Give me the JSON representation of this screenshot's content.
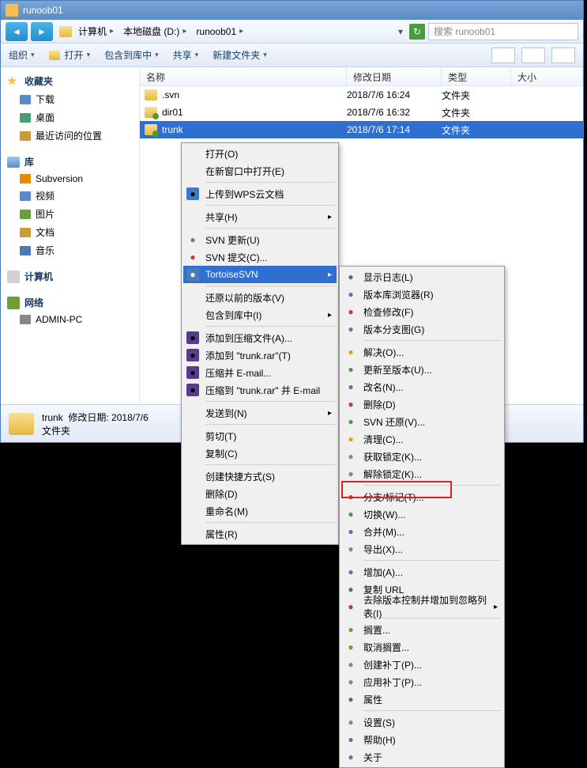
{
  "window": {
    "title": "runoob01"
  },
  "navbar": {
    "path": [
      {
        "label": "计算机"
      },
      {
        "label": "本地磁盘 (D:)"
      },
      {
        "label": "runoob01"
      }
    ],
    "search_placeholder": "搜索 runoob01"
  },
  "toolbar": {
    "organize": "组织",
    "open": "打开",
    "include": "包含到库中",
    "share": "共享",
    "newfolder": "新建文件夹"
  },
  "sidebar": {
    "favorites": {
      "title": "收藏夹",
      "items": [
        "下载",
        "桌面",
        "最近访问的位置"
      ]
    },
    "libraries": {
      "title": "库",
      "items": [
        "Subversion",
        "视频",
        "图片",
        "文档",
        "音乐"
      ]
    },
    "computer": {
      "title": "计算机"
    },
    "network": {
      "title": "网络",
      "items": [
        "ADMIN-PC"
      ]
    }
  },
  "columns": [
    "名称",
    "修改日期",
    "类型",
    "大小"
  ],
  "files": [
    {
      "name": ".svn",
      "date": "2018/7/6 16:24",
      "type": "文件夹"
    },
    {
      "name": "dir01",
      "date": "2018/7/6 16:32",
      "type": "文件夹"
    },
    {
      "name": "trunk",
      "date": "2018/7/6 17:14",
      "type": "文件夹"
    }
  ],
  "status": {
    "name": "trunk",
    "label1": "修改日期:",
    "date": "2018/7/6",
    "type": "文件夹"
  },
  "context1": [
    {
      "t": "打开(O)"
    },
    {
      "t": "在新窗口中打开(E)"
    },
    {
      "sep": true
    },
    {
      "t": "上传到WPS云文档",
      "ico": "wps"
    },
    {
      "sep": true
    },
    {
      "t": "共享(H)",
      "sub": true
    },
    {
      "sep": true
    },
    {
      "t": "SVN 更新(U)",
      "ico": "svn-u"
    },
    {
      "t": "SVN 提交(C)...",
      "ico": "svn-c"
    },
    {
      "t": "TortoiseSVN",
      "ico": "tsvn",
      "sub": true,
      "hl": true
    },
    {
      "sep": true
    },
    {
      "t": "还原以前的版本(V)"
    },
    {
      "t": "包含到库中(I)",
      "sub": true
    },
    {
      "sep": true
    },
    {
      "t": "添加到压缩文件(A)...",
      "ico": "rar"
    },
    {
      "t": "添加到 \"trunk.rar\"(T)",
      "ico": "rar"
    },
    {
      "t": "压缩并 E-mail...",
      "ico": "rar"
    },
    {
      "t": "压缩到 \"trunk.rar\" 并 E-mail",
      "ico": "rar"
    },
    {
      "sep": true
    },
    {
      "t": "发送到(N)",
      "sub": true
    },
    {
      "sep": true
    },
    {
      "t": "剪切(T)"
    },
    {
      "t": "复制(C)"
    },
    {
      "sep": true
    },
    {
      "t": "创建快捷方式(S)"
    },
    {
      "t": "删除(D)"
    },
    {
      "t": "重命名(M)"
    },
    {
      "sep": true
    },
    {
      "t": "属性(R)"
    }
  ],
  "context2": [
    {
      "t": "显示日志(L)",
      "ico": "log"
    },
    {
      "t": "版本库浏览器(R)",
      "ico": "repo"
    },
    {
      "t": "检查修改(F)",
      "ico": "check"
    },
    {
      "t": "版本分支图(G)",
      "ico": "graph"
    },
    {
      "sep": true
    },
    {
      "t": "解决(O)...",
      "ico": "resolve"
    },
    {
      "t": "更新至版本(U)...",
      "ico": "update"
    },
    {
      "t": "改名(N)...",
      "ico": "rename"
    },
    {
      "t": "删除(D)",
      "ico": "delete"
    },
    {
      "t": "SVN 还原(V)...",
      "ico": "revert"
    },
    {
      "t": "清理(C)...",
      "ico": "clean"
    },
    {
      "t": "获取锁定(K)...",
      "ico": "lock"
    },
    {
      "t": "解除锁定(K)...",
      "ico": "lock"
    },
    {
      "sep": true
    },
    {
      "t": "分支/标记(T)...",
      "ico": "branch"
    },
    {
      "t": "切换(W)...",
      "ico": "switch"
    },
    {
      "t": "合并(M)...",
      "ico": "merge"
    },
    {
      "t": "导出(X)...",
      "ico": "export"
    },
    {
      "sep": true
    },
    {
      "t": "增加(A)...",
      "ico": "add"
    },
    {
      "t": "复制 URL",
      "ico": "log"
    },
    {
      "t": "去除版本控制并增加到忽略列表(I)",
      "ico": "unver",
      "sub": true
    },
    {
      "sep": true
    },
    {
      "t": "搁置...",
      "ico": "shelve"
    },
    {
      "t": "取消搁置...",
      "ico": "shelve"
    },
    {
      "t": "创建补丁(P)...",
      "ico": "patch"
    },
    {
      "t": "应用补丁(P)...",
      "ico": "patch"
    },
    {
      "t": "属性",
      "ico": "log"
    },
    {
      "sep": true
    },
    {
      "t": "设置(S)",
      "ico": "settings"
    },
    {
      "t": "帮助(H)",
      "ico": "help"
    },
    {
      "t": "关于",
      "ico": "about"
    }
  ]
}
